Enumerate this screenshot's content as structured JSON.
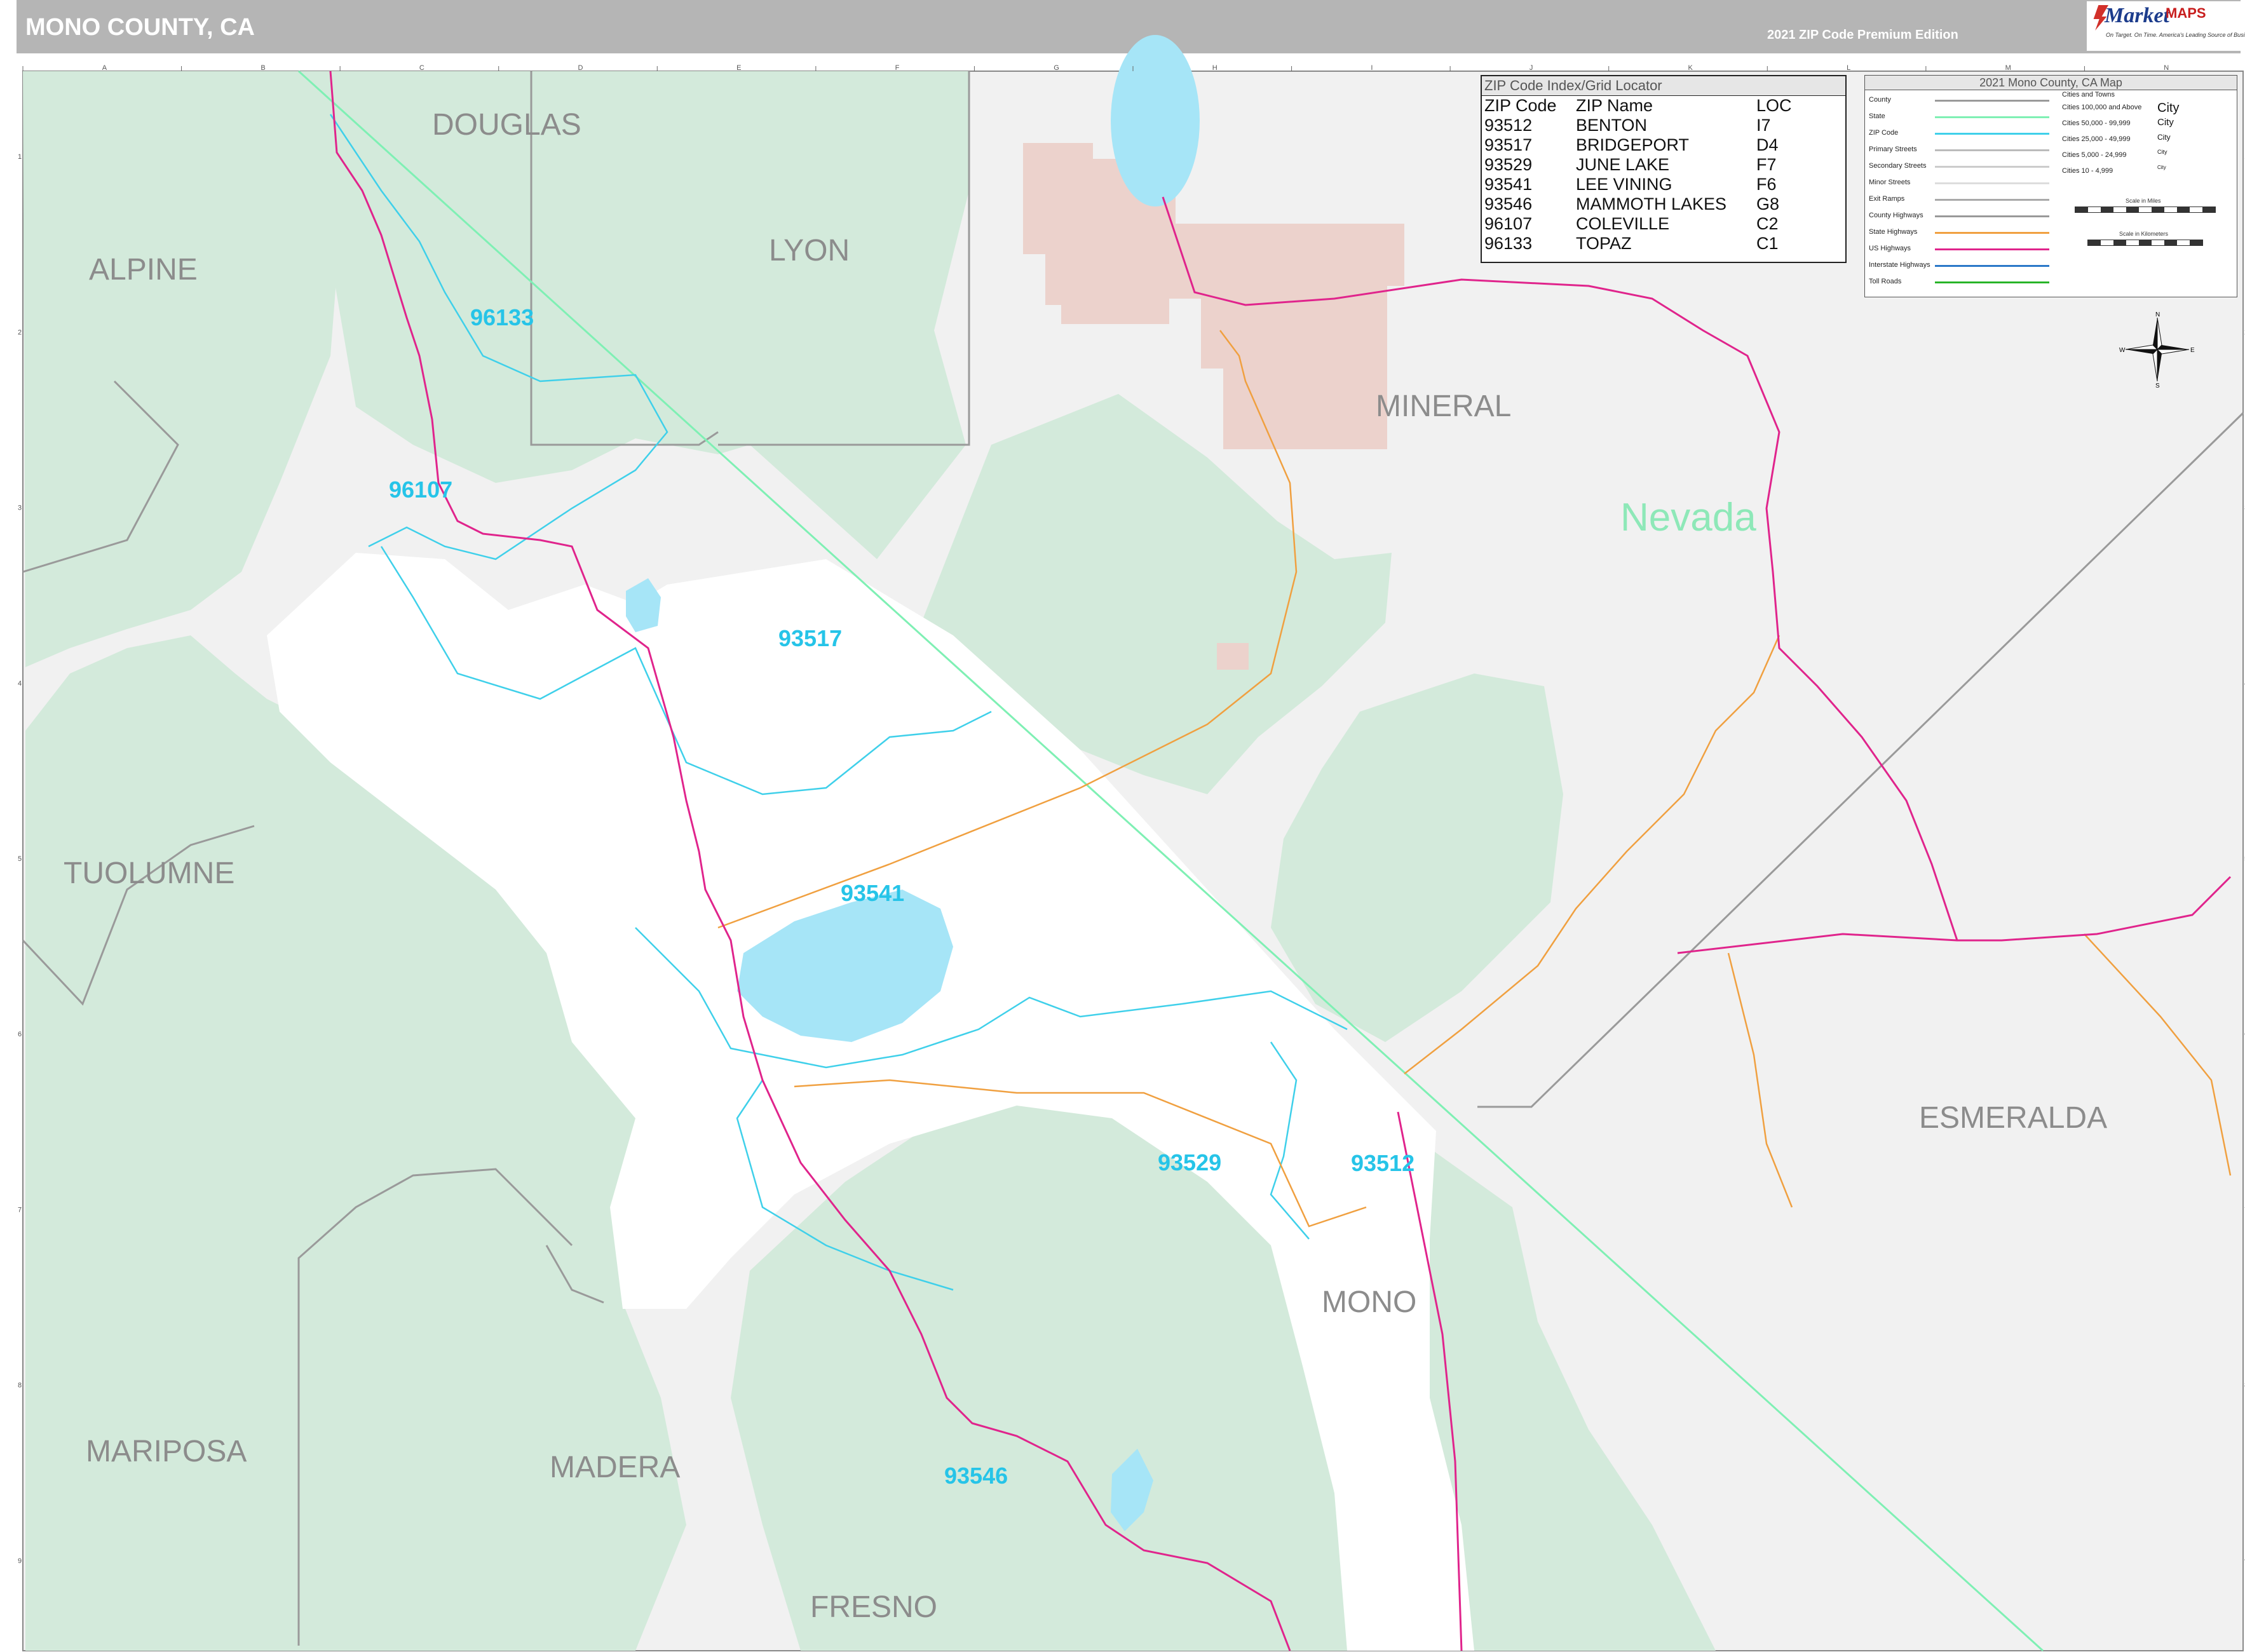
{
  "header": {
    "title": "MONO COUNTY, CA",
    "edition": "2021 ZIP Code Premium Edition"
  },
  "logo": {
    "brand_top": "Market",
    "brand_bottom": "MAPS",
    "tagline": "On Target. On Time. America's Leading Source of Business Maps"
  },
  "zip_index": {
    "title": "ZIP Code Index/Grid Locator",
    "headers": [
      "ZIP Code",
      "ZIP Name",
      "LOC"
    ],
    "rows": [
      [
        "93512",
        "BENTON",
        "I7"
      ],
      [
        "93517",
        "BRIDGEPORT",
        "D4"
      ],
      [
        "93529",
        "JUNE LAKE",
        "F7"
      ],
      [
        "93541",
        "LEE VINING",
        "F6"
      ],
      [
        "93546",
        "MAMMOTH LAKES",
        "G8"
      ],
      [
        "96107",
        "COLEVILLE",
        "C2"
      ],
      [
        "96133",
        "TOPAZ",
        "C1"
      ]
    ]
  },
  "legend": {
    "title": "2021 Mono County, CA Map",
    "items": [
      {
        "label": "County",
        "color": "#9a9a9a"
      },
      {
        "label": "State",
        "color": "#7ff0b4"
      },
      {
        "label": "ZIP Code",
        "color": "#3fd0ea"
      },
      {
        "label": "Primary Streets",
        "color": "#bbbbbb"
      },
      {
        "label": "Secondary Streets",
        "color": "#cccccc"
      },
      {
        "label": "Minor Streets",
        "color": "#dddddd"
      },
      {
        "label": "Exit Ramps",
        "color": "#aaaaaa"
      },
      {
        "label": "County Highways",
        "color": "#999999"
      },
      {
        "label": "State Highways",
        "color": "#f0a040"
      },
      {
        "label": "US Highways",
        "color": "#e0248c"
      },
      {
        "label": "Interstate Highways",
        "color": "#2a78c8"
      },
      {
        "label": "Toll Roads",
        "color": "#28b428"
      }
    ],
    "cities_title": "Cities and Towns",
    "cities": [
      {
        "label": "Cities 100,000 and Above",
        "sample": "City"
      },
      {
        "label": "Cities 50,000 - 99,999",
        "sample": "City"
      },
      {
        "label": "Cities 25,000 - 49,999",
        "sample": "City"
      },
      {
        "label": "Cities 5,000 - 24,999",
        "sample": "City"
      },
      {
        "label": "Cities 10 - 4,999",
        "sample": "City"
      }
    ],
    "scale_miles": "Scale in Miles",
    "scale_km": "Scale in Kilometers"
  },
  "compass": {
    "n": "N",
    "s": "S",
    "e": "E",
    "w": "W"
  },
  "grid": {
    "columns": [
      "A",
      "B",
      "C",
      "D",
      "E",
      "F",
      "G",
      "H",
      "I",
      "J",
      "K",
      "L",
      "M",
      "N"
    ],
    "rows": [
      "1",
      "2",
      "3",
      "4",
      "5",
      "6",
      "7",
      "8",
      "9"
    ]
  },
  "counties": [
    {
      "name": "DOUGLAS"
    },
    {
      "name": "LYON"
    },
    {
      "name": "ALPINE"
    },
    {
      "name": "MINERAL"
    },
    {
      "name": "TUOLUMNE"
    },
    {
      "name": "ESMERALDA"
    },
    {
      "name": "MONO"
    },
    {
      "name": "MARIPOSA"
    },
    {
      "name": "MADERA"
    },
    {
      "name": "FRESNO"
    }
  ],
  "state_label": "Nevada",
  "zip_labels": [
    "96133",
    "96107",
    "93517",
    "93541",
    "93529",
    "93512",
    "93546"
  ],
  "colors": {
    "forest": "#d3eadb",
    "land": "#f1f1f1",
    "mono_white": "#ffffff",
    "reservation": "#ecd2cc",
    "water": "#a6e5f7",
    "us_highway": "#e0248c",
    "state_highway": "#f0a040",
    "state_line": "#7ff0b4",
    "zip_line": "#3fd0ea",
    "county_line": "#9a9a9a"
  }
}
